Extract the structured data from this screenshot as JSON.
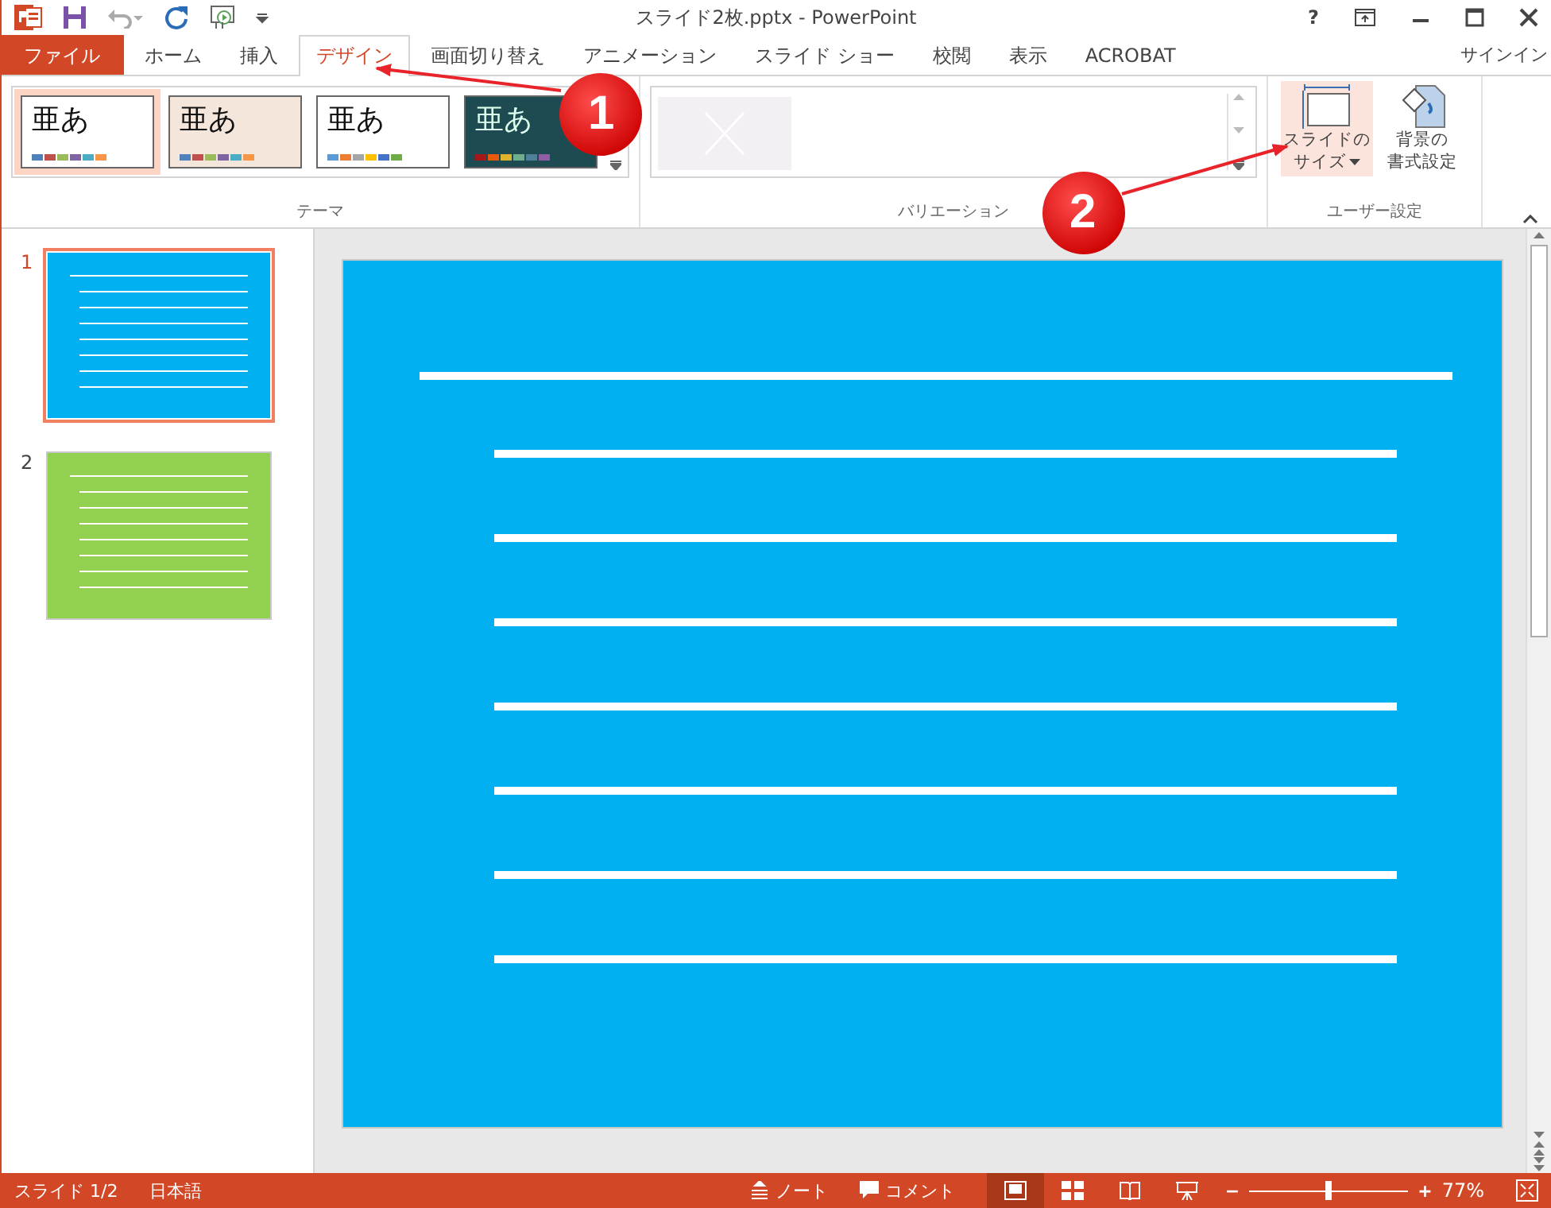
{
  "window": {
    "title": "スライド2枚.pptx - PowerPoint",
    "help": "?"
  },
  "tabs": [
    {
      "label": "ファイル",
      "kind": "file",
      "selected": false
    },
    {
      "label": "ホーム",
      "kind": "tab",
      "selected": false
    },
    {
      "label": "挿入",
      "kind": "tab",
      "selected": false
    },
    {
      "label": "デザイン",
      "kind": "tab",
      "selected": true
    },
    {
      "label": "画面切り替え",
      "kind": "tab",
      "selected": false
    },
    {
      "label": "アニメーション",
      "kind": "tab",
      "selected": false
    },
    {
      "label": "スライド ショー",
      "kind": "tab",
      "selected": false
    },
    {
      "label": "校閲",
      "kind": "tab",
      "selected": false
    },
    {
      "label": "表示",
      "kind": "tab",
      "selected": false
    },
    {
      "label": "ACROBAT",
      "kind": "tab",
      "selected": false
    }
  ],
  "sign_in": "サインイン",
  "themes": {
    "label": "テーマ",
    "items": [
      {
        "sample": "亜あ",
        "kind": "office",
        "selected": true
      },
      {
        "sample": "亜あ",
        "kind": "beige",
        "selected": false
      },
      {
        "sample": "亜あ",
        "kind": "plain",
        "selected": false
      },
      {
        "sample": "亜あ",
        "kind": "dark",
        "selected": false
      }
    ]
  },
  "variations": {
    "label": "バリエーション"
  },
  "customize": {
    "label": "ユーザー設定",
    "buttons": [
      {
        "lines": [
          "スライドの",
          "サイズ"
        ],
        "kind": "size",
        "hover": true
      },
      {
        "lines": [
          "背景の",
          "書式設定"
        ],
        "kind": "background",
        "hover": false
      }
    ]
  },
  "slides": [
    {
      "number": "1",
      "color": "#00b0f0",
      "selected": true
    },
    {
      "number": "2",
      "color": "#92d050",
      "selected": false
    }
  ],
  "annotations": [
    {
      "label": "1"
    },
    {
      "label": "2"
    }
  ],
  "status_bar": {
    "slide": "スライド 1/2",
    "language": "日本語",
    "notes": "ノート",
    "comments": "コメント",
    "views": [
      {
        "kind": "normal",
        "selected": true
      },
      {
        "kind": "sorter",
        "selected": false
      },
      {
        "kind": "reading",
        "selected": false
      },
      {
        "kind": "show",
        "selected": false
      }
    ],
    "zoom_out": "−",
    "zoom_in": "+",
    "level": 0.5,
    "zoom": "77%"
  }
}
